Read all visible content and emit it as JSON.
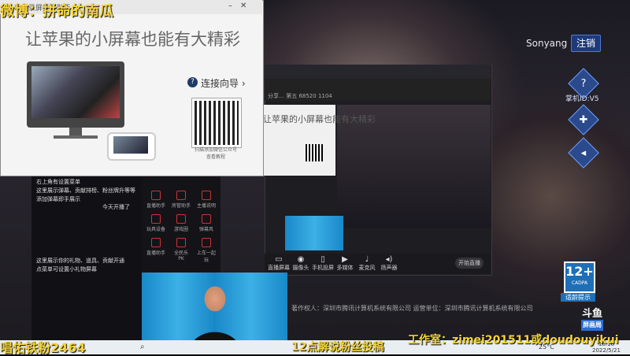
{
  "overlay": {
    "weibo": "微博：拼命的南瓜",
    "fans_group": "唱佑铁粉2464",
    "studio": "工作室：zimei201511或doudouyikui",
    "boost": "12点解说粉丝投稿"
  },
  "account": {
    "username": "Sonyang",
    "logout_label": "注销"
  },
  "side": {
    "gamepad_label": "掌机ID:V5"
  },
  "connect_window": {
    "title": "苹果录屏投屏助手",
    "slogan": "让苹果的小屏幕也能有大精彩",
    "guide_link": "连接向导 ›",
    "qr_caption": "扫描添加微信公众号 查看教程"
  },
  "client": {
    "subtitle": "分享…  第五  68520  1104",
    "nested_slogan": "让苹果的小屏幕也能有大精彩",
    "toolbar": [
      {
        "icon": "screen-icon",
        "glyph": "▭",
        "label": "直播屏幕"
      },
      {
        "icon": "camera-icon",
        "glyph": "◉",
        "label": "摄像头"
      },
      {
        "icon": "phone-icon",
        "glyph": "▯",
        "label": "手机投屏"
      },
      {
        "icon": "media-icon",
        "glyph": "▶",
        "label": "多媒体"
      },
      {
        "icon": "mic-icon",
        "glyph": "♩",
        "label": "麦克风"
      },
      {
        "icon": "speaker-icon",
        "glyph": "◂)",
        "label": "扬声器"
      }
    ],
    "start_label": "开始直播"
  },
  "chat": [
    "右上角有设置菜单",
    "这里展示弹幕、贡献排榜、粉丝牌升等等",
    "添加弹幕即手展示",
    "今天开播了",
    "这里展示你的礼物、道具、贡献开通",
    "点菜单可设置小礼物屏幕"
  ],
  "grid": [
    "直播助手",
    "房管助手",
    "主播说明",
    "玩具设备",
    "游戏圈",
    "弹幕风",
    "直播助手",
    "全民乐PK",
    "上车一起玩"
  ],
  "age_rating": {
    "number": "12+",
    "org": "CADPA",
    "label": "适龄提示"
  },
  "logo": {
    "text": "斗鱼",
    "sub": "屏画局"
  },
  "copyright": "著作权人：深圳市腾讯计算机系统有限公司  运营单位：深圳市腾讯计算机系统有限公司",
  "taskbar": {
    "weather": "25°C",
    "time": "18:18",
    "date": "2022/5/21"
  }
}
